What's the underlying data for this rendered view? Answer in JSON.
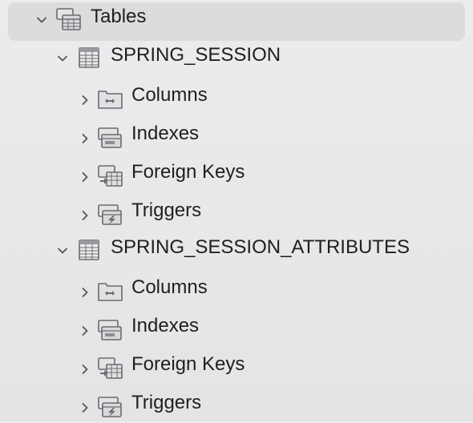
{
  "tree": {
    "root": {
      "label": "Tables",
      "icon": "tables-folder-icon",
      "expanded": true,
      "selected": true
    },
    "tables": [
      {
        "label": "SPRING_SESSION",
        "icon": "table-icon",
        "expanded": true,
        "children": [
          {
            "label": "Columns",
            "icon": "columns-folder-icon",
            "expanded": false
          },
          {
            "label": "Indexes",
            "icon": "indexes-folder-icon",
            "expanded": false
          },
          {
            "label": "Foreign Keys",
            "icon": "foreign-keys-folder-icon",
            "expanded": false
          },
          {
            "label": "Triggers",
            "icon": "triggers-folder-icon",
            "expanded": false
          }
        ]
      },
      {
        "label": "SPRING_SESSION_ATTRIBUTES",
        "icon": "table-icon",
        "expanded": true,
        "children": [
          {
            "label": "Columns",
            "icon": "columns-folder-icon",
            "expanded": false
          },
          {
            "label": "Indexes",
            "icon": "indexes-folder-icon",
            "expanded": false
          },
          {
            "label": "Foreign Keys",
            "icon": "foreign-keys-folder-icon",
            "expanded": false
          },
          {
            "label": "Triggers",
            "icon": "triggers-folder-icon",
            "expanded": false
          }
        ]
      }
    ]
  },
  "colors": {
    "selection": "#dcdcde",
    "text": "#1f1f1f",
    "chevron": "#555555",
    "icon_stroke": "#6b6b6e",
    "icon_fill": "#d9d9dc",
    "background": "#ececee"
  }
}
